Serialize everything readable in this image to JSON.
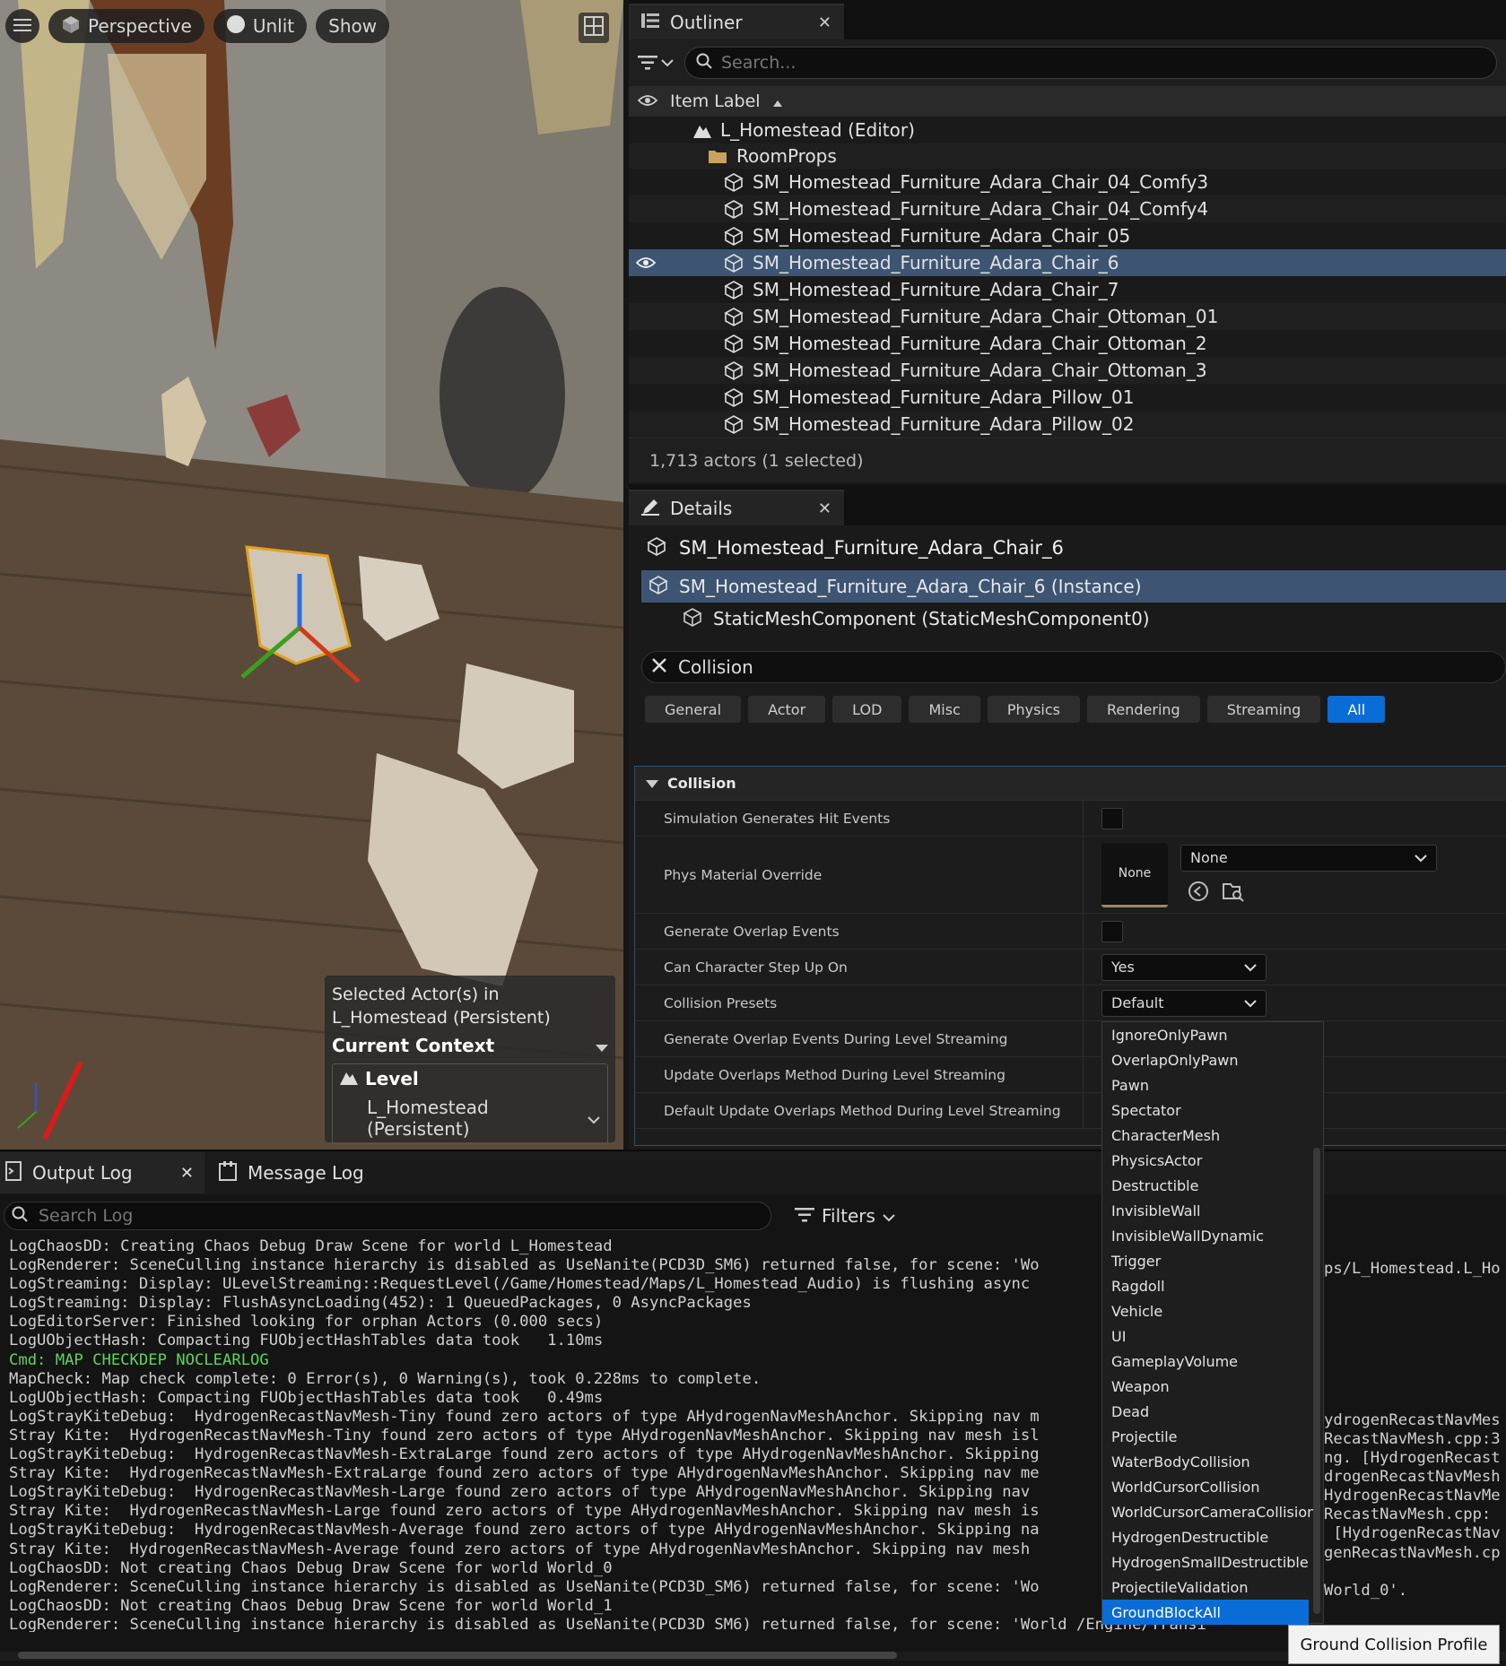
{
  "viewport": {
    "menu_icon": "hamburger-icon",
    "perspective_label": "Perspective",
    "unlit_label": "Unlit",
    "show_label": "Show",
    "context": {
      "selected_line1": "Selected Actor(s) in",
      "selected_line2": "L_Homestead (Persistent)",
      "current_context": "Current Context",
      "level_label": "Level",
      "level_value": "L_Homestead (Persistent)"
    }
  },
  "outliner": {
    "tab_label": "Outliner",
    "search_placeholder": "Search...",
    "column_header": "Item Label",
    "items": [
      {
        "label": "L_Homestead (Editor)",
        "kind": "level"
      },
      {
        "label": "RoomProps",
        "kind": "folder"
      },
      {
        "label": "SM_Homestead_Furniture_Adara_Chair_04_Comfy3",
        "kind": "mesh"
      },
      {
        "label": "SM_Homestead_Furniture_Adara_Chair_04_Comfy4",
        "kind": "mesh"
      },
      {
        "label": "SM_Homestead_Furniture_Adara_Chair_05",
        "kind": "mesh"
      },
      {
        "label": "SM_Homestead_Furniture_Adara_Chair_6",
        "kind": "mesh",
        "selected": true
      },
      {
        "label": "SM_Homestead_Furniture_Adara_Chair_7",
        "kind": "mesh"
      },
      {
        "label": "SM_Homestead_Furniture_Adara_Chair_Ottoman_01",
        "kind": "mesh"
      },
      {
        "label": "SM_Homestead_Furniture_Adara_Chair_Ottoman_2",
        "kind": "mesh"
      },
      {
        "label": "SM_Homestead_Furniture_Adara_Chair_Ottoman_3",
        "kind": "mesh"
      },
      {
        "label": "SM_Homestead_Furniture_Adara_Pillow_01",
        "kind": "mesh"
      },
      {
        "label": "SM_Homestead_Furniture_Adara_Pillow_02",
        "kind": "mesh"
      }
    ],
    "status": "1,713 actors (1 selected)"
  },
  "details": {
    "tab_label": "Details",
    "actor_name": "SM_Homestead_Furniture_Adara_Chair_6",
    "instance_label": "SM_Homestead_Furniture_Adara_Chair_6 (Instance)",
    "component_label": "StaticMeshComponent (StaticMeshComponent0)",
    "filter_text": "Collision",
    "categories": [
      "General",
      "Actor",
      "LOD",
      "Misc",
      "Physics",
      "Rendering",
      "Streaming",
      "All"
    ],
    "active_category": "All",
    "section_label": "Collision",
    "properties": {
      "sim_hit": "Simulation Generates Hit Events",
      "phys_mat": "Phys Material Override",
      "phys_mat_thumb": "None",
      "phys_mat_value": "None",
      "gen_overlap": "Generate Overlap Events",
      "step_up": "Can Character Step Up On",
      "step_up_value": "Yes",
      "presets": "Collision Presets",
      "presets_value": "Default",
      "overlap_streaming": "Generate Overlap Events During Level Streaming",
      "update_overlaps": "Update Overlaps Method During Level Streaming",
      "default_update": "Default Update Overlaps Method During Level Streaming"
    }
  },
  "presets_dropdown": {
    "options": [
      "IgnoreOnlyPawn",
      "OverlapOnlyPawn",
      "Pawn",
      "Spectator",
      "CharacterMesh",
      "PhysicsActor",
      "Destructible",
      "InvisibleWall",
      "InvisibleWallDynamic",
      "Trigger",
      "Ragdoll",
      "Vehicle",
      "UI",
      "GameplayVolume",
      "Weapon",
      "Dead",
      "Projectile",
      "WaterBodyCollision",
      "WorldCursorCollision",
      "WorldCursorCameraCollision",
      "HydrogenDestructible",
      "HydrogenSmallDestructible",
      "ProjectileValidation",
      "GroundBlockAll"
    ],
    "highlighted": "GroundBlockAll",
    "tooltip": "Ground Collision Profile"
  },
  "log": {
    "output_tab": "Output Log",
    "message_tab": "Message Log",
    "search_placeholder": "Search Log",
    "filters_label": "Filters",
    "lines": [
      "LogChaosDD: Creating Chaos Debug Draw Scene for world L_Homestead",
      "LogRenderer: SceneCulling instance hierarchy is disabled as UseNanite(PCD3D_SM6) returned false, for scene: 'Wo",
      "LogStreaming: Display: ULevelStreaming::RequestLevel(/Game/Homestead/Maps/L_Homestead_Audio) is flushing async",
      "LogStreaming: Display: FlushAsyncLoading(452): 1 QueuedPackages, 0 AsyncPackages",
      "LogEditorServer: Finished looking for orphan Actors (0.000 secs)",
      "LogUObjectHash: Compacting FUObjectHashTables data took   1.10ms",
      "Cmd: MAP CHECKDEP NOCLEARLOG",
      "MapCheck: Map check complete: 0 Error(s), 0 Warning(s), took 0.228ms to complete.",
      "LogUObjectHash: Compacting FUObjectHashTables data took   0.49ms",
      "LogStrayKiteDebug:  HydrogenRecastNavMesh-Tiny found zero actors of type AHydrogenNavMeshAnchor. Skipping nav m",
      "Stray Kite:  HydrogenRecastNavMesh-Tiny found zero actors of type AHydrogenNavMeshAnchor. Skipping nav mesh isl",
      "LogStrayKiteDebug:  HydrogenRecastNavMesh-ExtraLarge found zero actors of type AHydrogenNavMeshAnchor. Skipping",
      "Stray Kite:  HydrogenRecastNavMesh-ExtraLarge found zero actors of type AHydrogenNavMeshAnchor. Skipping nav me",
      "LogStrayKiteDebug:  HydrogenRecastNavMesh-Large found zero actors of type AHydrogenNavMeshAnchor. Skipping nav",
      "Stray Kite:  HydrogenRecastNavMesh-Large found zero actors of type AHydrogenNavMeshAnchor. Skipping nav mesh is",
      "LogStrayKiteDebug:  HydrogenRecastNavMesh-Average found zero actors of type AHydrogenNavMeshAnchor. Skipping na",
      "Stray Kite:  HydrogenRecastNavMesh-Average found zero actors of type AHydrogenNavMeshAnchor. Skipping nav mesh",
      "LogChaosDD: Not creating Chaos Debug Draw Scene for world World_0",
      "LogRenderer: SceneCulling instance hierarchy is disabled as UseNanite(PCD3D_SM6) returned false, for scene: 'Wo",
      "LogChaosDD: Not creating Chaos Debug Draw Scene for world World_1",
      "LogRenderer: SceneCulling instance hierarchy is disabled as UseNanite(PCD3D_SM6) returned false, for scene: 'World /Engine/Transi"
    ],
    "lines_right": [
      "",
      "ps/L_Homestead.L_Ho",
      "",
      "",
      "",
      "",
      "",
      "",
      "",
      "ydrogenRecastNavMes",
      "RecastNavMesh.cpp:3",
      "ng. [HydrogenRecast",
      "drogenRecastNavMesh",
      "HydrogenRecastNavMe",
      "RecastNavMesh.cpp:",
      " [HydrogenRecastNav",
      "genRecastNavMesh.cp",
      "",
      "World_0'.",
      "",
      ""
    ]
  },
  "colors": {
    "accent_blue": "#0a6cd6",
    "selection": "#3d5573",
    "cmd_green": "#5fd35f"
  }
}
